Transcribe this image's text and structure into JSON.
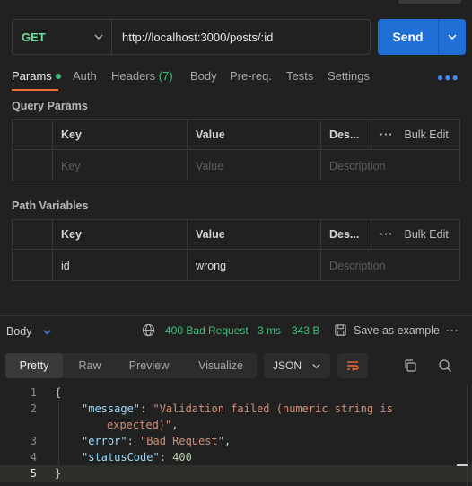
{
  "request": {
    "method": "GET",
    "url": "http://localhost:3000/posts/:id",
    "send_label": "Send"
  },
  "tabs": {
    "params": "Params",
    "auth": "Auth",
    "headers": "Headers",
    "headers_count": "(7)",
    "body": "Body",
    "prereq": "Pre-req.",
    "tests": "Tests",
    "settings": "Settings"
  },
  "query_params": {
    "title": "Query Params",
    "headers": {
      "key": "Key",
      "value": "Value",
      "desc": "Des...",
      "bulk_edit": "Bulk Edit"
    },
    "placeholders": {
      "key": "Key",
      "value": "Value",
      "desc": "Description"
    }
  },
  "path_variables": {
    "title": "Path Variables",
    "headers": {
      "key": "Key",
      "value": "Value",
      "desc": "Des...",
      "bulk_edit": "Bulk Edit"
    },
    "rows": [
      {
        "key": "id",
        "value": "wrong"
      }
    ],
    "desc_placeholder": "Description"
  },
  "response": {
    "body_label": "Body",
    "status": "400 Bad Request",
    "time": "3 ms",
    "size": "343 B",
    "save_label": "Save as example",
    "view_tabs": [
      "Pretty",
      "Raw",
      "Preview",
      "Visualize"
    ],
    "active_view": "Pretty",
    "format": "JSON"
  },
  "code": {
    "line_numbers": [
      "1",
      "2",
      "3",
      "4",
      "5"
    ],
    "open_brace": "{",
    "close_brace": "}",
    "message_key": "\"message\"",
    "message_val_1": "\"Validation failed (numeric string is",
    "message_val_2": "expected)\"",
    "error_key": "\"error\"",
    "error_val": "\"Bad Request\"",
    "status_key": "\"statusCode\"",
    "status_val": "400"
  },
  "colors": {
    "accent_orange": "#f26b3a",
    "send_blue": "#1f6fd6",
    "success_green": "#3fc07a",
    "method_green": "#6bdd9a"
  },
  "icons": [
    "chevron-down-icon",
    "globe-icon",
    "save-icon",
    "wrap-lines-icon",
    "copy-icon",
    "search-icon",
    "more-options-icon"
  ]
}
